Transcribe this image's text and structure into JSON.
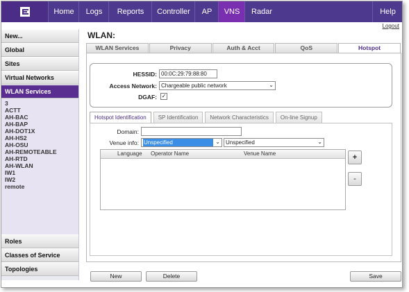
{
  "nav": {
    "logo_icon": "brand-logo-icon",
    "items": [
      "Home",
      "Logs",
      "Reports",
      "Controller",
      "AP",
      "VNS",
      "Radar",
      "Help"
    ],
    "active": "VNS",
    "logout": "Logout"
  },
  "sidebar": {
    "new": "New...",
    "global": "Global",
    "sites": "Sites",
    "virtual_networks": "Virtual Networks",
    "wlan_services": "WLAN Services",
    "wlan_items": [
      "3",
      "ACTT",
      "AH-BAC",
      "AH-BAP",
      "AH-DOT1X",
      "AH-HS2",
      "AH-OSU",
      "AH-REMOTEABLE",
      "AH-RTD",
      "AH-WLAN",
      "IW1",
      "IW2",
      "remote"
    ],
    "roles": "Roles",
    "classes_of_service": "Classes of Service",
    "topologies": "Topologies"
  },
  "main": {
    "title": "WLAN:",
    "tabs": [
      "WLAN Services",
      "Privacy",
      "Auth & Acct",
      "QoS",
      "Hotspot"
    ],
    "active_tab": "Hotspot",
    "hessid_label": "HESSID:",
    "hessid_value": "00:0C:29:79:88:80",
    "access_network_label": "Access Network:",
    "access_network_value": "Chargeable public network",
    "dgaf_label": "DGAF:",
    "dgaf_checked": "✓",
    "subtabs": [
      "Hotspot Identification",
      "SP Identification",
      "Network Characteristics",
      "On-line Signup"
    ],
    "domain_label": "Domain:",
    "domain_value": "",
    "venue_info_label": "Venue info:",
    "venue_group_value": "Unspecified",
    "venue_type_value": "Unspecified",
    "grid_headers": [
      "Language",
      "Operator Name",
      "Venue Name"
    ],
    "add_button": "+",
    "remove_button": "-"
  },
  "footer": {
    "new": "New",
    "delete": "Delete",
    "save": "Save"
  },
  "colors": {
    "nav_bg": "#4d3a8f",
    "nav_active": "#7a2fb0",
    "sidebar_active": "#5a2d91",
    "selected_highlight": "#3a8ee6"
  }
}
